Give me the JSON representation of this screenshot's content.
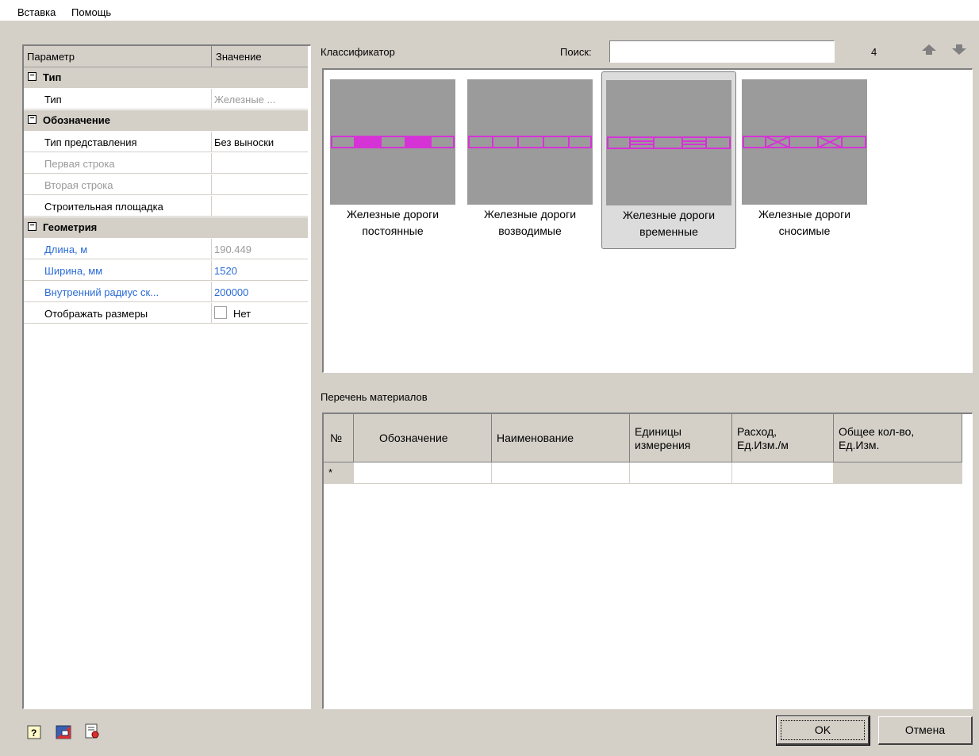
{
  "menu": {
    "items": [
      "Вставка",
      "Помощь"
    ]
  },
  "properties": {
    "col_param": "Параметр",
    "col_value": "Значение",
    "categories": {
      "type": "Тип",
      "designation": "Обозначение",
      "geometry": "Геометрия"
    },
    "rows": {
      "type_name": "Тип",
      "type_value": "Железные ...",
      "repr_name": "Тип представления",
      "repr_value": "Без выноски",
      "first_line": "Первая строка",
      "second_line": "Вторая строка",
      "site": "Строительная площадка",
      "length_name": "Длина, м",
      "length_value": "190.449",
      "width_name": "Ширина, мм",
      "width_value": "1520",
      "radius_name": "Внутренний радиус ск...",
      "radius_value": "200000",
      "dims_name": "Отображать размеры",
      "dims_value": "Нет"
    },
    "collapse_glyph": "−"
  },
  "classifier": {
    "title": "Классификатор",
    "search_label": "Поиск:",
    "search_value": "",
    "count": "4",
    "items": [
      {
        "line1": "Железные дороги",
        "line2": "постоянные"
      },
      {
        "line1": "Железные дороги",
        "line2": "возводимые"
      },
      {
        "line1": "Железные дороги",
        "line2": "временные"
      },
      {
        "line1": "Железные дороги",
        "line2": "сносимые"
      }
    ],
    "selected_index": 2,
    "accent_color": "#d633d6",
    "tile_color": "#9b9b9b"
  },
  "materials": {
    "title": "Перечень материалов",
    "columns": {
      "num": "№",
      "designation": "Обозначение",
      "name": "Наименование",
      "units_1": "Единицы",
      "units_2": "измерения",
      "rate_1": "Расход,",
      "rate_2": "Ед.Изм./м",
      "total_1": "Общее кол-во,",
      "total_2": "Ед.Изм."
    },
    "new_row_marker": "*"
  },
  "buttons": {
    "ok": "OK",
    "cancel": "Отмена"
  }
}
